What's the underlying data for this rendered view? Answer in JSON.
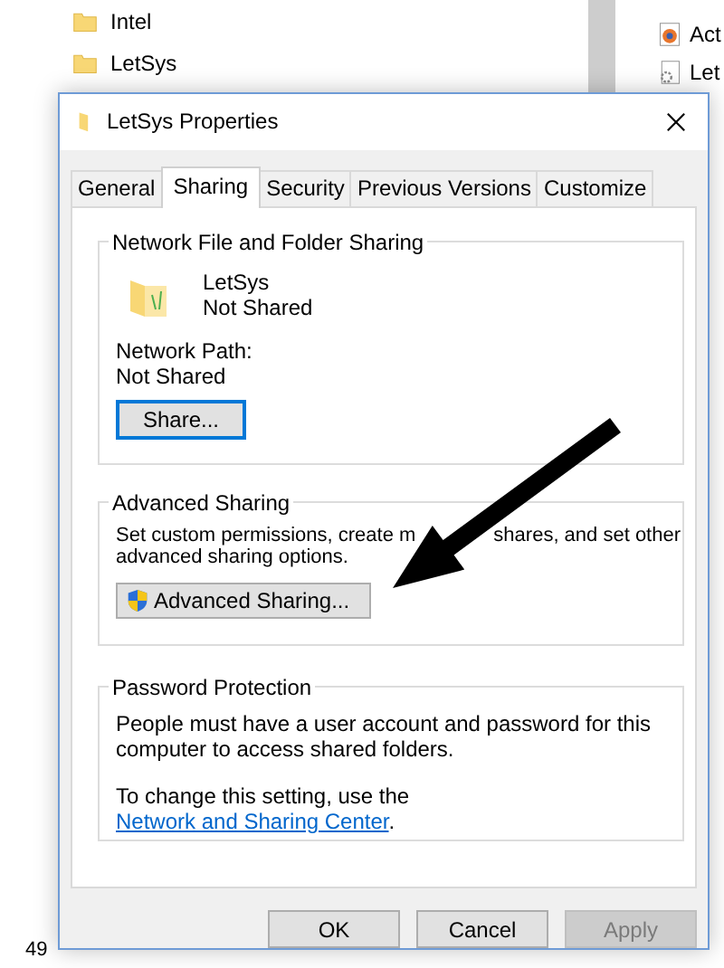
{
  "explorer": {
    "folders": [
      "Intel",
      "LetSys"
    ],
    "right_files": [
      {
        "label": "Act",
        "kind": "firefox"
      },
      {
        "label": "Let",
        "kind": "settings"
      }
    ],
    "status_bar": "49"
  },
  "dialog": {
    "title": "LetSys Properties",
    "tabs": [
      {
        "label": "General",
        "selected": false
      },
      {
        "label": "Sharing",
        "selected": true
      },
      {
        "label": "Security",
        "selected": false
      },
      {
        "label": "Previous Versions",
        "selected": false
      },
      {
        "label": "Customize",
        "selected": false
      }
    ],
    "network_group": {
      "title": "Network File and Folder Sharing",
      "folder_name": "LetSys",
      "folder_status": "Not Shared",
      "path_label": "Network Path:",
      "path_value": "Not Shared",
      "button": "Share..."
    },
    "advanced_group": {
      "title": "Advanced Sharing",
      "description_before_arrow": "Set custom permissions, create m",
      "description_after_arrow": "shares, and set other",
      "description_line_2": "advanced sharing options.",
      "button": "Advanced Sharing..."
    },
    "password_group": {
      "title": "Password Protection",
      "description": "People must have a user account and password for this computer to access shared folders.",
      "link_sentence_prefix": "To change this setting, use the ",
      "link": "Network and Sharing Center",
      "link_sentence_suffix": "."
    },
    "buttons": [
      {
        "label": "OK",
        "disabled": false
      },
      {
        "label": "Cancel",
        "disabled": false
      },
      {
        "label": "Apply",
        "disabled": true
      }
    ]
  }
}
